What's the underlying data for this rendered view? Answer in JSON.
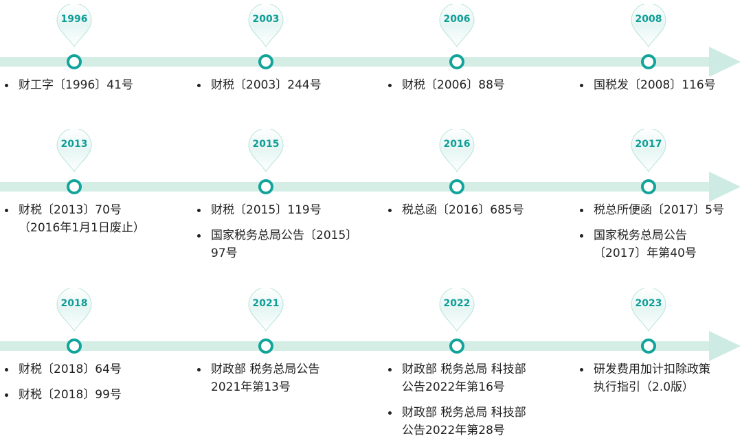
{
  "rows": [
    {
      "events": [
        {
          "year": "1996",
          "docs": [
            {
              "lines": [
                "财工字〔1996〕41号"
              ]
            }
          ]
        },
        {
          "year": "2003",
          "docs": [
            {
              "lines": [
                "财税〔2003〕244号"
              ]
            }
          ]
        },
        {
          "year": "2006",
          "docs": [
            {
              "lines": [
                "财税〔2006〕88号"
              ]
            }
          ]
        },
        {
          "year": "2008",
          "docs": [
            {
              "lines": [
                "国税发〔2008〕116号"
              ]
            }
          ]
        }
      ]
    },
    {
      "events": [
        {
          "year": "2013",
          "docs": [
            {
              "lines": [
                "财税〔2013〕70号",
                "（2016年1月1日废止）"
              ]
            }
          ]
        },
        {
          "year": "2015",
          "docs": [
            {
              "lines": [
                "财税〔2015〕119号"
              ]
            },
            {
              "lines": [
                "国家税务总局公告〔2015〕",
                "97号"
              ]
            }
          ]
        },
        {
          "year": "2016",
          "docs": [
            {
              "lines": [
                "税总函〔2016〕685号"
              ]
            }
          ]
        },
        {
          "year": "2017",
          "docs": [
            {
              "lines": [
                "税总所便函〔2017〕5号"
              ]
            },
            {
              "lines": [
                "国家税务总局公告",
                "〔2017〕年第40号"
              ]
            }
          ]
        }
      ]
    },
    {
      "events": [
        {
          "year": "2018",
          "docs": [
            {
              "lines": [
                "财税〔2018〕64号"
              ]
            },
            {
              "lines": [
                "财税〔2018〕99号"
              ]
            }
          ]
        },
        {
          "year": "2021",
          "docs": [
            {
              "lines": [
                "财政部 税务总局公告",
                "2021年第13号"
              ]
            }
          ]
        },
        {
          "year": "2022",
          "docs": [
            {
              "lines": [
                "财政部 税务总局 科技部",
                "公告2022年第16号"
              ]
            },
            {
              "lines": [
                "财政部 税务总局 科技部",
                "公告2022年第28号"
              ]
            }
          ]
        },
        {
          "year": "2023",
          "docs": [
            {
              "lines": [
                "研发费用加计扣除政策",
                "执行指引（2.0版）"
              ]
            }
          ]
        }
      ]
    }
  ],
  "colors": {
    "node": "#12a49b",
    "bar": "#d4eee6",
    "pin_fill": "#e6f6f3",
    "year_text": "#0f9d97"
  },
  "icons": {
    "pin": "map-pin-icon"
  }
}
